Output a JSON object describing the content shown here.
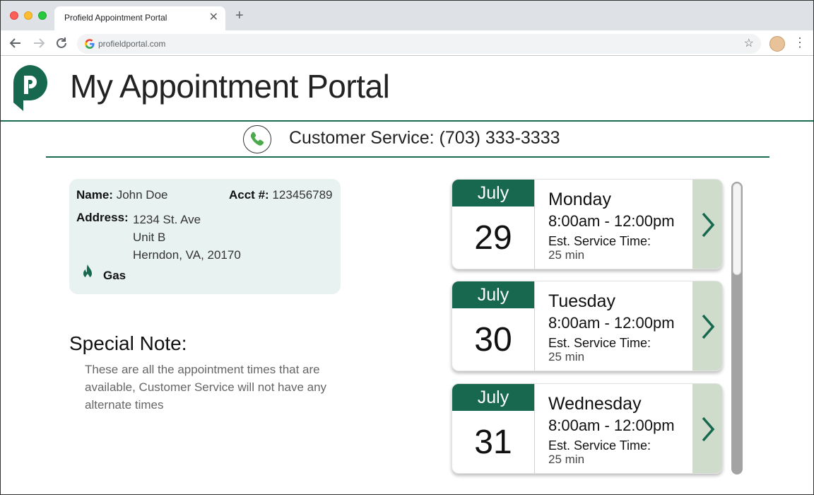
{
  "browser": {
    "tab_title": "Profield Appointment Portal",
    "tab_close": "✕",
    "new_tab": "+",
    "url": "profieldportal.com",
    "icons": [
      "back-arrow-icon",
      "forward-arrow-icon",
      "reload-icon",
      "google-icon",
      "star-icon",
      "profile-icon",
      "menu-dots-icon"
    ]
  },
  "header": {
    "title": "My Appointment Portal",
    "logo_icon": "profield-logo",
    "customer_service": "Customer Service: (703) 333-3333"
  },
  "customer": {
    "name_label": "Name:",
    "name": "John Doe",
    "acct_label": "Acct #:",
    "acct": "123456789",
    "address_label": "Address:",
    "address_line1": "1234 St. Ave",
    "address_line2": "Unit B",
    "address_line3": "Herndon, VA, 20170",
    "service_type": "Gas"
  },
  "note": {
    "title": "Special Note:",
    "body": "These are all the appointment times that are available, Customer Service will not have any alternate times"
  },
  "appointments": [
    {
      "month": "July",
      "day": "29",
      "weekday": "Monday",
      "time": "8:00am - 12:00pm",
      "est_label": "Est. Service Time:",
      "est_value": "25 min"
    },
    {
      "month": "July",
      "day": "30",
      "weekday": "Tuesday",
      "time": "8:00am - 12:00pm",
      "est_label": "Est. Service Time:",
      "est_value": "25 min"
    },
    {
      "month": "July",
      "day": "31",
      "weekday": "Wednesday",
      "time": "8:00am - 12:00pm",
      "est_label": "Est. Service Time:",
      "est_value": "25 min"
    }
  ],
  "colors": {
    "brand_green": "#17684f",
    "card_bg": "#e8f2f1",
    "chevron_bg": "#cfdbcb"
  }
}
